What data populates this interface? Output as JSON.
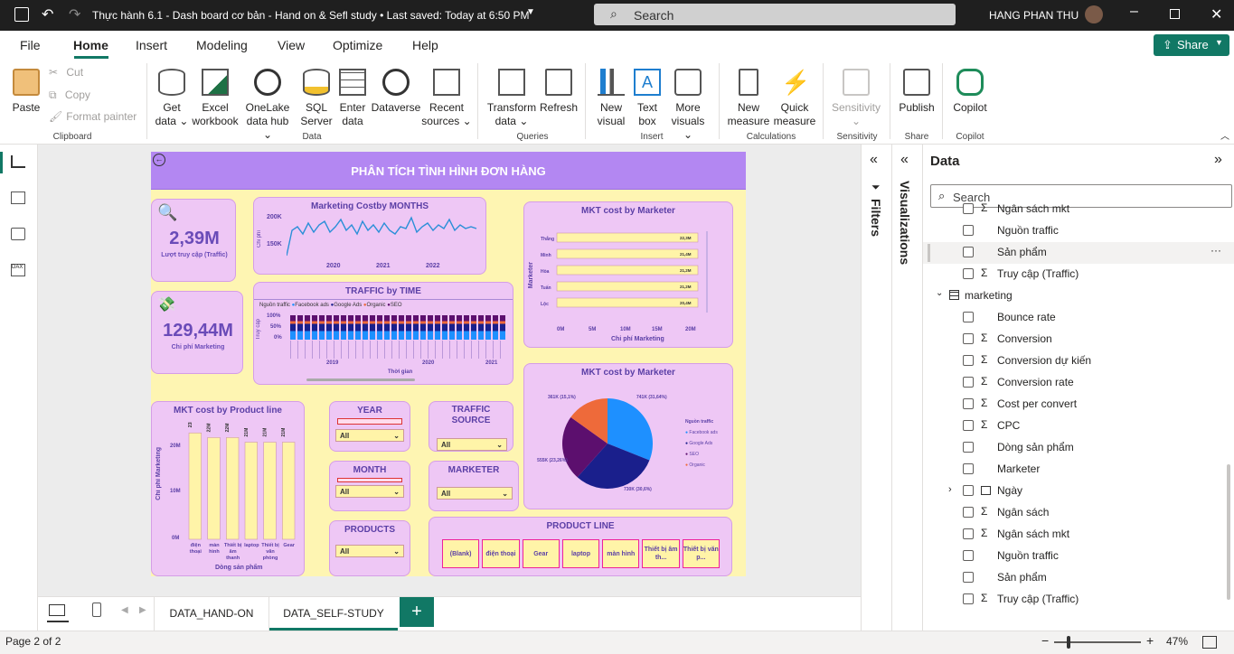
{
  "titlebar": {
    "doc_title": "Thực hành 6.1 - Dash board cơ bản - Hand on & Sefl study • Last saved: Today at 6:50 PM",
    "search_placeholder": "Search",
    "user": "HANG PHAN THU"
  },
  "menu": [
    "File",
    "Home",
    "Insert",
    "Modeling",
    "View",
    "Optimize",
    "Help"
  ],
  "share_label": "Share",
  "ribbon": {
    "paste": "Paste",
    "cut": "Cut",
    "copy": "Copy",
    "format_painter": "Format painter",
    "get_data": [
      "Get",
      "data"
    ],
    "excel": [
      "Excel",
      "workbook"
    ],
    "onelake": [
      "OneLake",
      "data hub"
    ],
    "sql": [
      "SQL",
      "Server"
    ],
    "enter": [
      "Enter",
      "data"
    ],
    "dataverse": "Dataverse",
    "recent": [
      "Recent",
      "sources"
    ],
    "transform": [
      "Transform",
      "data"
    ],
    "refresh": "Refresh",
    "new_visual": [
      "New",
      "visual"
    ],
    "text_box": [
      "Text",
      "box"
    ],
    "more_visuals": [
      "More",
      "visuals"
    ],
    "new_measure": [
      "New",
      "measure"
    ],
    "quick_measure": [
      "Quick",
      "measure"
    ],
    "sensitivity": "Sensitivity",
    "publish": "Publish",
    "copilot": "Copilot",
    "groups": {
      "clipboard": "Clipboard",
      "data": "Data",
      "queries": "Queries",
      "insert": "Insert",
      "calculations": "Calculations",
      "sensitivity": "Sensitivity",
      "share": "Share",
      "copilot": "Copilot"
    }
  },
  "report": {
    "title": "PHÂN TÍCH TÌNH HÌNH ĐƠN HÀNG",
    "kpi1": {
      "value": "2,39M",
      "label": "Lượt truy cập (Traffic)"
    },
    "kpi2": {
      "value": "129,44M",
      "label": "Chi phí Marketing"
    },
    "months_chart": {
      "title": "Marketing Costby MONTHS",
      "ylabel": "Chi phí",
      "yticks": [
        "200K",
        "150K"
      ],
      "xticks": [
        "2020",
        "2021",
        "2022"
      ]
    },
    "traffic_time": {
      "title": "TRAFFIC by TIME",
      "legend_title": "Nguồn traffic",
      "legend": [
        "Facebook ads",
        "Google Ads",
        "Organic",
        "SEO"
      ],
      "ylabel": "Truy cập",
      "yticks": [
        "100%",
        "50%",
        "0%"
      ],
      "years": [
        "2019",
        "2020",
        "2021"
      ],
      "xlabel": "Thời gian"
    },
    "mkt_marketer": {
      "title": "MKT cost by Marketer",
      "ylabel": "Marketer",
      "xlabel": "Chi phí Marketing",
      "xticks": [
        "0M",
        "5M",
        "10M",
        "15M",
        "20M"
      ]
    },
    "mkt_pie": {
      "title": "MKT cost by Marketer",
      "legend_title": "Nguồn traffic",
      "legend": [
        "Facebook ads",
        "Google Ads",
        "SEO",
        "Organic"
      ],
      "labels": [
        "741K (31,64%)",
        "730K (30,6%)",
        "555K (23,26%)",
        "361K (15,1%)"
      ]
    },
    "product_line_chart": {
      "title": "MKT cost by Product line",
      "ylabel": "Chi phí Marketing",
      "xlabel": "Dòng sản phẩm",
      "yticks": [
        "20M",
        "10M",
        "0M"
      ]
    },
    "slicers": {
      "year": "YEAR",
      "month": "MONTH",
      "products": "PRODUCTS",
      "traffic_source": "TRAFFIC SOURCE",
      "marketer": "MARKETER",
      "all": "All"
    },
    "product_line": {
      "title": "PRODUCT LINE",
      "buttons": [
        "(Blank)",
        "điện thoại",
        "Gear",
        "laptop",
        "màn hình",
        "Thiết bị âm th...",
        "Thiết bị văn p..."
      ]
    }
  },
  "chart_data": [
    {
      "type": "bar",
      "title": "MKT cost by Marketer",
      "categories": [
        "Thắng",
        "Minh",
        "Hòa",
        "Tuấn",
        "Lộc"
      ],
      "values": [
        22.3,
        21.4,
        21.2,
        21.2,
        20.4
      ],
      "labels": [
        "22,3M",
        "21,4M",
        "21,2M",
        "21,2M",
        "20,4M"
      ],
      "xlabel": "Chi phí Marketing",
      "ylabel": "Marketer",
      "xlim": [
        0,
        20
      ]
    },
    {
      "type": "pie",
      "title": "MKT cost by Marketer",
      "categories": [
        "Facebook ads",
        "Google Ads",
        "SEO",
        "Organic"
      ],
      "values": [
        741,
        730,
        555,
        361
      ],
      "labels": [
        "741K (31,64%)",
        "730K (30,6%)",
        "555K (23,26%)",
        "361K (15,1%)"
      ],
      "colors": [
        "#1e90ff",
        "#1a1f8c",
        "#5c0f6e",
        "#ee6a3a"
      ]
    },
    {
      "type": "bar",
      "title": "MKT cost by Product line",
      "categories": [
        "điện thoại",
        "màn hình",
        "Thiết bị âm thanh",
        "laptop",
        "Thiết bị văn phòng",
        "Gear"
      ],
      "values": [
        23,
        22,
        22,
        21,
        21,
        21
      ],
      "labels": [
        "23M",
        "22M",
        "22M",
        "21M",
        "21M",
        "21M"
      ],
      "xlabel": "Dòng sản phẩm",
      "ylabel": "Chi phí Marketing",
      "ylim": [
        0,
        25
      ]
    }
  ],
  "tabs": [
    "DATA_HAND-ON",
    "DATA_SELF-STUDY"
  ],
  "status": {
    "page": "Page 2 of 2",
    "zoom": "47%"
  },
  "panes": {
    "filters": "Filters",
    "visualizations": "Visualizations",
    "data_title": "Data",
    "search_placeholder": "Search"
  },
  "data_fields_top": [
    {
      "sigma": true,
      "name": "Ngân sách mkt"
    },
    {
      "sigma": false,
      "name": "Nguồn traffic"
    },
    {
      "sigma": false,
      "name": "Sản phẩm"
    },
    {
      "sigma": true,
      "name": "Truy cập (Traffic)"
    }
  ],
  "table_name": "marketing",
  "data_fields": [
    {
      "sigma": false,
      "name": "Bounce rate"
    },
    {
      "sigma": true,
      "name": "Conversion"
    },
    {
      "sigma": true,
      "name": "Conversion dự kiến"
    },
    {
      "sigma": true,
      "name": "Conversion rate"
    },
    {
      "sigma": true,
      "name": "Cost per convert"
    },
    {
      "sigma": true,
      "name": "CPC"
    },
    {
      "sigma": false,
      "name": "Dòng sản phẩm"
    },
    {
      "sigma": false,
      "name": "Marketer"
    },
    {
      "sigma": false,
      "name": "Ngày",
      "calendar": true
    },
    {
      "sigma": true,
      "name": "Ngân sách"
    },
    {
      "sigma": true,
      "name": "Ngân sách mkt"
    },
    {
      "sigma": false,
      "name": "Nguồn traffic"
    },
    {
      "sigma": false,
      "name": "Sản phẩm"
    },
    {
      "sigma": true,
      "name": "Truy cập (Traffic)"
    }
  ]
}
